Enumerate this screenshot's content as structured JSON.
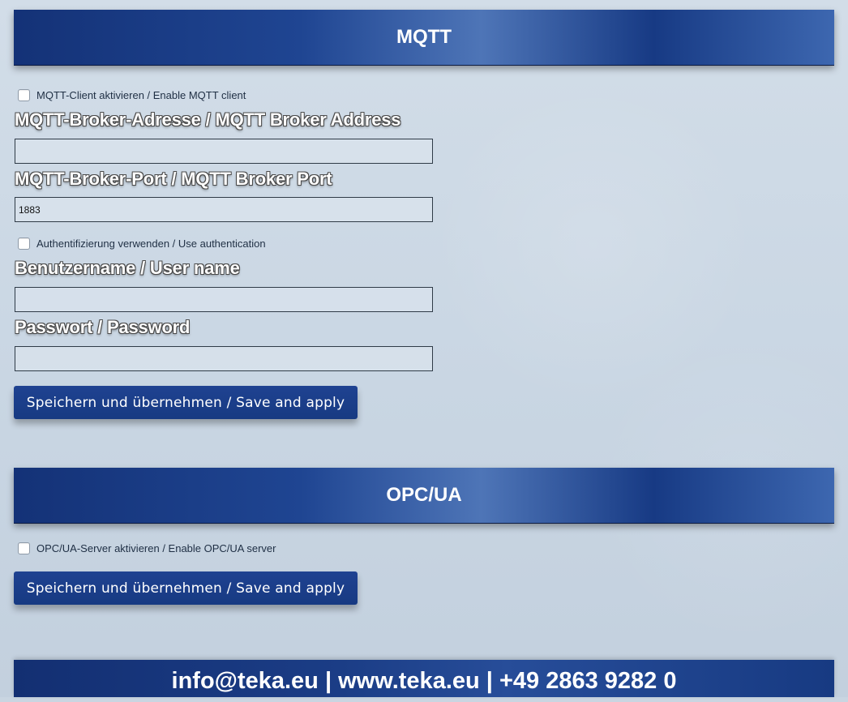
{
  "mqtt": {
    "title": "MQTT",
    "enable_client_label": "MQTT-Client aktivieren / Enable MQTT client",
    "broker_address_label": "MQTT-Broker-Adresse / MQTT Broker Address",
    "broker_address_value": "",
    "broker_port_label": "MQTT-Broker-Port / MQTT Broker Port",
    "broker_port_value": "1883",
    "use_auth_label": "Authentifizierung verwenden / Use authentication",
    "username_label": "Benutzername / User name",
    "username_value": "",
    "password_label": "Passwort / Password",
    "password_value": "",
    "save_button_label": "Speichern und übernehmen / Save and apply"
  },
  "opcua": {
    "title": "OPC/UA",
    "enable_server_label": "OPC/UA-Server aktivieren / Enable OPC/UA server",
    "save_button_label": "Speichern und übernehmen / Save and apply"
  },
  "footer": {
    "text": "info@teka.eu | www.teka.eu | +49 2863 9282 0"
  }
}
